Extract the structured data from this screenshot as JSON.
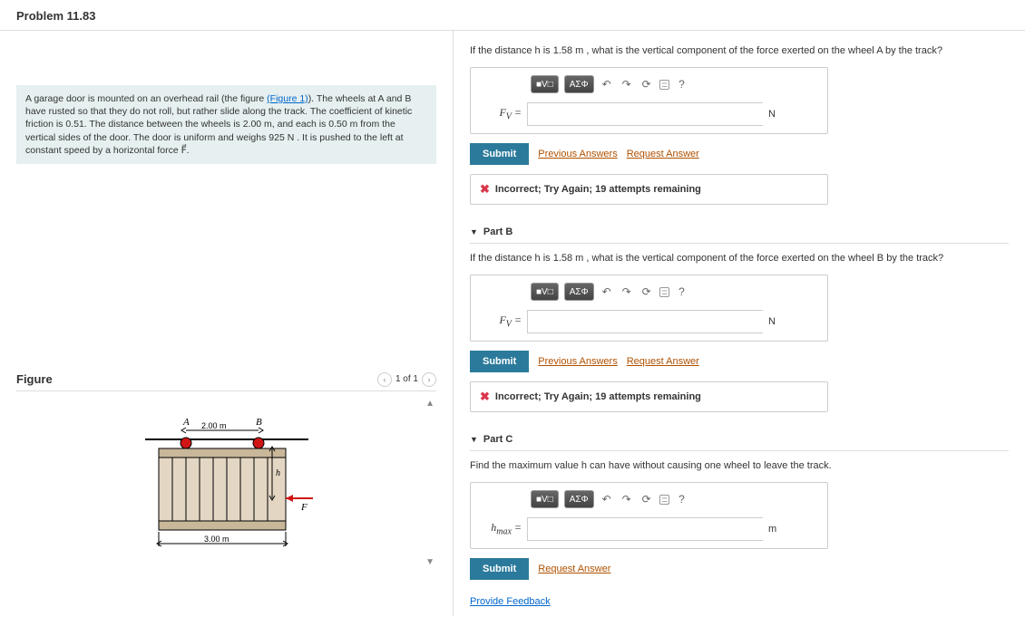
{
  "header": {
    "title": "Problem 11.83"
  },
  "problem": {
    "text_before_link": "A garage door is mounted on an overhead rail (the figure ",
    "link_text": "(Figure 1)",
    "text_after_link": "). The wheels at A and B have rusted so that they do not roll, but rather slide along the track. The coefficient of kinetic friction is 0.51. The distance between the wheels is 2.00 m, and each is 0.50 m from the vertical sides of the door. The door is uniform and weighs 925 N . It is pushed to the left at constant speed by a horizontal force F⃗."
  },
  "figure": {
    "title": "Figure",
    "nav_text": "1 of 1",
    "labels": {
      "A": "A",
      "B": "B",
      "top_dim": "2.00 m",
      "h": "h",
      "F": "F",
      "bottom_dim": "3.00 m"
    }
  },
  "toolbar": {
    "templates": "V□",
    "greek": "ΑΣΦ",
    "undo": "↶",
    "redo": "↷",
    "reset": "⟳",
    "keyboard": "⌨",
    "help": "?"
  },
  "partA": {
    "question": "If the distance h is 1.58 m , what is the vertical component of the force exerted on the wheel A by the track?",
    "var": "F_V =",
    "unit": "N",
    "submit": "Submit",
    "prev_answers": "Previous Answers",
    "request": "Request Answer",
    "feedback": "Incorrect; Try Again; 19 attempts remaining"
  },
  "partB": {
    "header": "Part B",
    "question": "If the distance h is 1.58 m , what is the vertical component of the force exerted on the wheel B by the track?",
    "var": "F_V =",
    "unit": "N",
    "submit": "Submit",
    "prev_answers": "Previous Answers",
    "request": "Request Answer",
    "feedback": "Incorrect; Try Again; 19 attempts remaining"
  },
  "partC": {
    "header": "Part C",
    "question": "Find the maximum value h can have without causing one wheel to leave the track.",
    "var": "h_max =",
    "unit": "m",
    "submit": "Submit",
    "request": "Request Answer"
  },
  "feedback_link": "Provide Feedback"
}
